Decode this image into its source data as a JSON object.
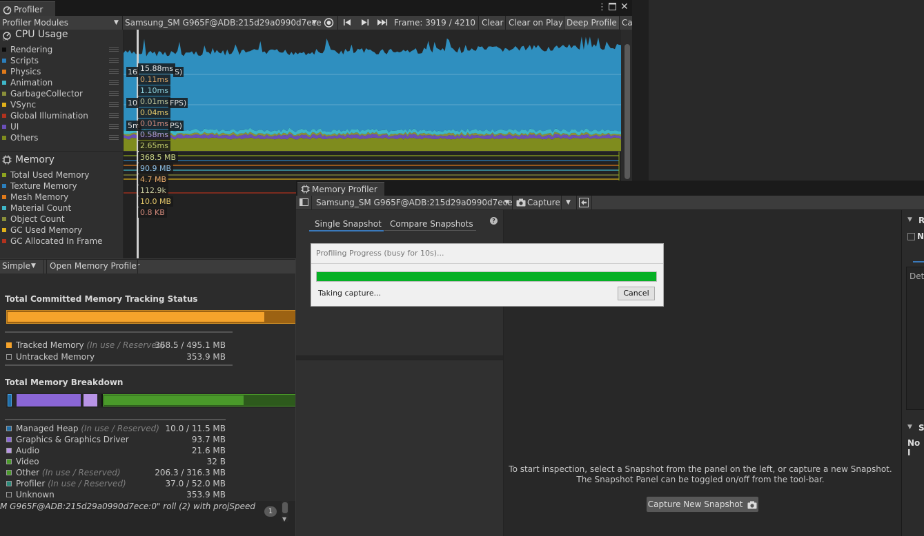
{
  "profiler": {
    "tab_title": "Profiler",
    "toolbar": {
      "modules_dropdown": "Profiler Modules",
      "device": "Samsung_SM G965F@ADB:215d29a0990d7ece",
      "frame": "Frame: 3919 / 4210",
      "clear": "Clear",
      "clear_on_play": "Clear on Play",
      "deep_profile": "Deep Profile",
      "cut": "Ca"
    },
    "cpu": {
      "title": "CPU Usage",
      "legend": [
        {
          "label": "Rendering",
          "color": "#0b0b0b"
        },
        {
          "label": "Scripts",
          "color": "#2b7fbd"
        },
        {
          "label": "Physics",
          "color": "#e07a1a"
        },
        {
          "label": "Animation",
          "color": "#3fb7c8"
        },
        {
          "label": "GarbageCollector",
          "color": "#8a8f3a"
        },
        {
          "label": "VSync",
          "color": "#e0b11a"
        },
        {
          "label": "Global Illumination",
          "color": "#b2321e"
        },
        {
          "label": "UI",
          "color": "#6a4fb8"
        },
        {
          "label": "Others",
          "color": "#7f8c1e"
        }
      ],
      "values": [
        "15.88ms",
        "0.11ms",
        "1.10ms",
        "0.01ms",
        "0.04ms",
        "0.01ms",
        "0.58ms",
        "2.65ms"
      ],
      "fps_lines": [
        "16",
        "10",
        "5m"
      ],
      "fps_suffixes": [
        "S)",
        "FPS)",
        "PS)"
      ]
    },
    "memory": {
      "title": "Memory",
      "legend": [
        {
          "label": "Total Used Memory",
          "color": "#8ea51f"
        },
        {
          "label": "Texture Memory",
          "color": "#2b7fbd"
        },
        {
          "label": "Mesh Memory",
          "color": "#e07a1a"
        },
        {
          "label": "Material Count",
          "color": "#3fb7c8"
        },
        {
          "label": "Object Count",
          "color": "#8a8f3a"
        },
        {
          "label": "GC Used Memory",
          "color": "#e0b11a"
        },
        {
          "label": "GC Allocated In Frame",
          "color": "#b2321e"
        }
      ],
      "values": [
        "368.5 MB",
        "90.9 MB",
        "4.7 MB",
        "112.9k",
        "10.0 MB",
        "0.8 KB"
      ]
    },
    "details_toolbar": {
      "view_mode": "Simple",
      "open_memory_profiler": "Open Memory Profiler"
    },
    "details": {
      "committed_title": "Total Committed Memory Tracking Status",
      "tracked_fraction": 0.895,
      "tracked": {
        "label": "Tracked Memory",
        "hint": "(In use / Reserved)",
        "value": "368.5 / 495.1 MB"
      },
      "untracked": {
        "label": "Untracked Memory",
        "value": "353.9 MB"
      },
      "breakdown_title": "Total Memory Breakdown",
      "breakdown": [
        {
          "label": "Managed Heap",
          "hint": "(In use / Reserved)",
          "value": "10.0 / 11.5 MB",
          "color": "#1f6ea8"
        },
        {
          "label": "Graphics & Graphics Driver",
          "hint": "",
          "value": "93.7 MB",
          "color": "#8a66d6"
        },
        {
          "label": "Audio",
          "hint": "",
          "value": "21.6 MB",
          "color": "#b894e6"
        },
        {
          "label": "Video",
          "hint": "",
          "value": "32 B",
          "color": "#4a9a2a"
        },
        {
          "label": "Other",
          "hint": "(In use / Reserved)",
          "value": "206.3 / 316.3 MB",
          "color": "#4a9a2a"
        },
        {
          "label": "Profiler",
          "hint": "(In use / Reserved)",
          "value": "37.0 / 52.0 MB",
          "color": "#2a8a7a"
        },
        {
          "label": "Unknown",
          "hint": "",
          "value": "353.9 MB",
          "color": "#2c2c2c"
        }
      ]
    },
    "console": {
      "text": "M G965F@ADB:215d29a0990d7ece:0\" roll (2) with projSpeed",
      "count": "1"
    }
  },
  "memory_profiler": {
    "tab_title": "Memory Profiler",
    "toolbar": {
      "device": "Samsung_SM G965F@ADB:215d29a0990d7ece",
      "capture": "Capture"
    },
    "tabs": [
      {
        "label": "Single Snapshot"
      },
      {
        "label": "Compare Snapshots"
      }
    ],
    "help": "?",
    "empty_line1": "To start inspection, select a Snapshot from the panel on the left, or capture a new Snapshot.",
    "empty_line2": "The Snapshot Panel can be toggled on/off from the tool-bar.",
    "capture_new": "Capture New Snapshot",
    "right_panel": {
      "r": "R",
      "n": "N",
      "det": "Det",
      "s": "S",
      "no": "No I"
    }
  },
  "dialog": {
    "title": "Profiling Progress (busy for 10s)...",
    "status": "Taking capture...",
    "cancel": "Cancel",
    "progress": 1.0
  }
}
